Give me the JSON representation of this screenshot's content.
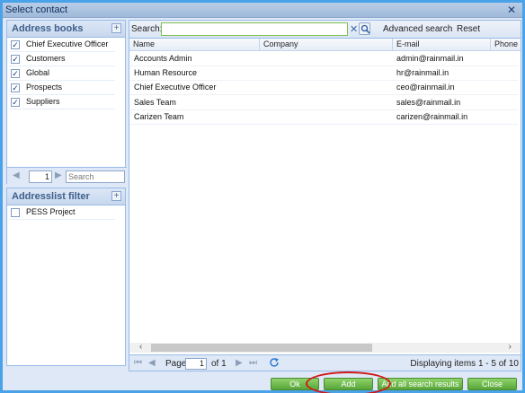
{
  "window": {
    "title": "Select contact",
    "close_glyph": "✕"
  },
  "address_books": {
    "header": "Address books",
    "add_glyph": "+",
    "items": [
      {
        "label": "Chief Executive Officer",
        "checked": true
      },
      {
        "label": "Customers",
        "checked": true
      },
      {
        "label": "Global",
        "checked": true
      },
      {
        "label": "Prospects",
        "checked": true
      },
      {
        "label": "Suppliers",
        "checked": true
      }
    ],
    "pager": {
      "page": "1",
      "search_placeholder": "Search"
    }
  },
  "addresslist_filter": {
    "header": "Addresslist filter",
    "add_glyph": "+",
    "items": [
      {
        "label": "PESS Project",
        "checked": false
      }
    ]
  },
  "search_bar": {
    "label": "Search:",
    "value": "",
    "clear_glyph": "✕",
    "advanced_label": "Advanced search",
    "reset_label": "Reset"
  },
  "grid": {
    "columns": [
      "Name",
      "Company",
      "E-mail",
      "Phone"
    ],
    "rows": [
      {
        "name": "Accounts Admin",
        "company": "",
        "email": "admin@rainmail.in",
        "phone": ""
      },
      {
        "name": "Human Resource",
        "company": "",
        "email": "hr@rainmail.in",
        "phone": ""
      },
      {
        "name": "Chief Executive Officer",
        "company": "",
        "email": "ceo@rainmail.in",
        "phone": ""
      },
      {
        "name": "Sales Team",
        "company": "",
        "email": "sales@rainmail.in",
        "phone": ""
      },
      {
        "name": "Carizen Team",
        "company": "",
        "email": "carizen@rainmail.in",
        "phone": ""
      }
    ]
  },
  "pager": {
    "page_label": "Page",
    "page": "1",
    "of_label": "of 1",
    "display": "Displaying items 1 - 5 of 10"
  },
  "buttons": {
    "ok": "Ok",
    "add": "Add",
    "add_all": "Add all search results",
    "close": "Close"
  },
  "colors": {
    "accent": "#4aa3e8",
    "button_green": "#58a53a",
    "highlight_red": "#d01818"
  }
}
